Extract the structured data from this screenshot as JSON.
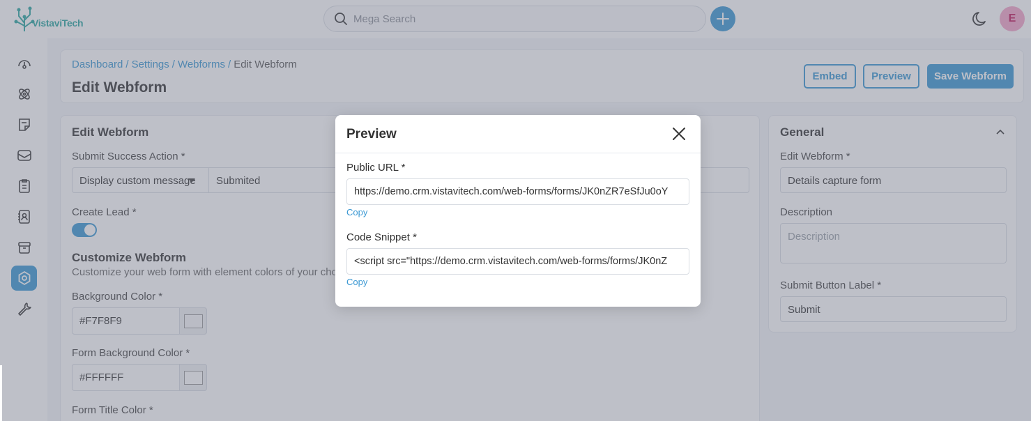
{
  "brand": {
    "name": "VistaviTech"
  },
  "search": {
    "placeholder": "Mega Search"
  },
  "user": {
    "avatar_initial": "E"
  },
  "sidebar": {
    "items": [
      {
        "icon": "gauge-icon"
      },
      {
        "icon": "atom-icon"
      },
      {
        "icon": "note-icon"
      },
      {
        "icon": "inbox-icon"
      },
      {
        "icon": "clipboard-icon"
      },
      {
        "icon": "contact-book-icon"
      },
      {
        "icon": "archive-icon"
      },
      {
        "icon": "settings-icon",
        "active": true
      },
      {
        "icon": "wrench-icon"
      }
    ]
  },
  "breadcrumb": {
    "items": [
      "Dashboard",
      "Settings",
      "Webforms"
    ],
    "current": "Edit Webform"
  },
  "page": {
    "title": "Edit Webform",
    "buttons": {
      "embed": "Embed",
      "preview": "Preview",
      "save": "Save Webform"
    }
  },
  "edit_form": {
    "title": "Edit Webform",
    "submit_success_label": "Submit Success Action *",
    "submit_success_value": "Display custom message",
    "submit_message_value": "Submited",
    "create_lead_label": "Create Lead *",
    "create_lead_enabled": true,
    "customize_title": "Customize Webform",
    "customize_subtitle": "Customize your web form with element colors of your choice",
    "bg_color_label": "Background Color *",
    "bg_color_value": "#F7F8F9",
    "form_bg_color_label": "Form Background Color *",
    "form_bg_color_value": "#FFFFFF",
    "form_title_color_label": "Form Title Color *"
  },
  "general": {
    "title": "General",
    "name_label": "Edit Webform *",
    "name_value": "Details capture form",
    "description_label": "Description",
    "description_placeholder": "Description",
    "submit_label_label": "Submit Button Label *",
    "submit_label_value": "Submit"
  },
  "modal": {
    "title": "Preview",
    "public_url_label": "Public URL *",
    "public_url_value": "https://demo.crm.vistavitech.com/web-forms/forms/JK0nZR7eSfJu0oY",
    "copy_label": "Copy",
    "code_snippet_label": "Code Snippet *",
    "code_snippet_value": "<script src=\"https://demo.crm.vistavitech.com/web-forms/forms/JK0nZ"
  },
  "colors": {
    "accent": "#3a98d3",
    "brand": "#2aa7a0",
    "avatar_bg": "#f5a5c8"
  }
}
